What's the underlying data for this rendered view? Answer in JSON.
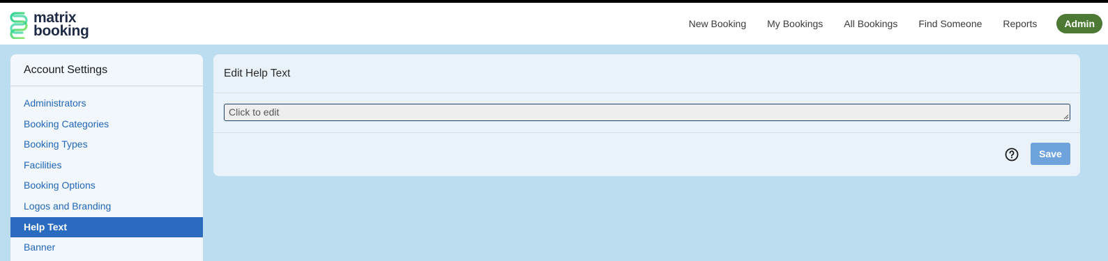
{
  "brand": {
    "line1": "matrix",
    "line2": "booking",
    "logo_icon": "matrix-booking-logo-icon",
    "colors": [
      "#2fd19a",
      "#9be86a"
    ]
  },
  "nav": {
    "items": [
      {
        "label": "New Booking"
      },
      {
        "label": "My Bookings"
      },
      {
        "label": "All Bookings"
      },
      {
        "label": "Find Someone"
      },
      {
        "label": "Reports"
      }
    ],
    "admin_label": "Admin",
    "admin_color": "#4c7a34"
  },
  "sidebar": {
    "title": "Account Settings",
    "items": [
      {
        "label": "Administrators"
      },
      {
        "label": "Booking Categories"
      },
      {
        "label": "Booking Types"
      },
      {
        "label": "Facilities"
      },
      {
        "label": "Booking Options"
      },
      {
        "label": "Logos and Branding"
      },
      {
        "label": "Help Text",
        "active": true
      },
      {
        "label": "Banner"
      }
    ],
    "active_color": "#2a6bbf"
  },
  "panel": {
    "title": "Edit Help Text",
    "edit_placeholder": "Click to edit",
    "help_icon": "question-circle-icon",
    "save_label": "Save"
  }
}
